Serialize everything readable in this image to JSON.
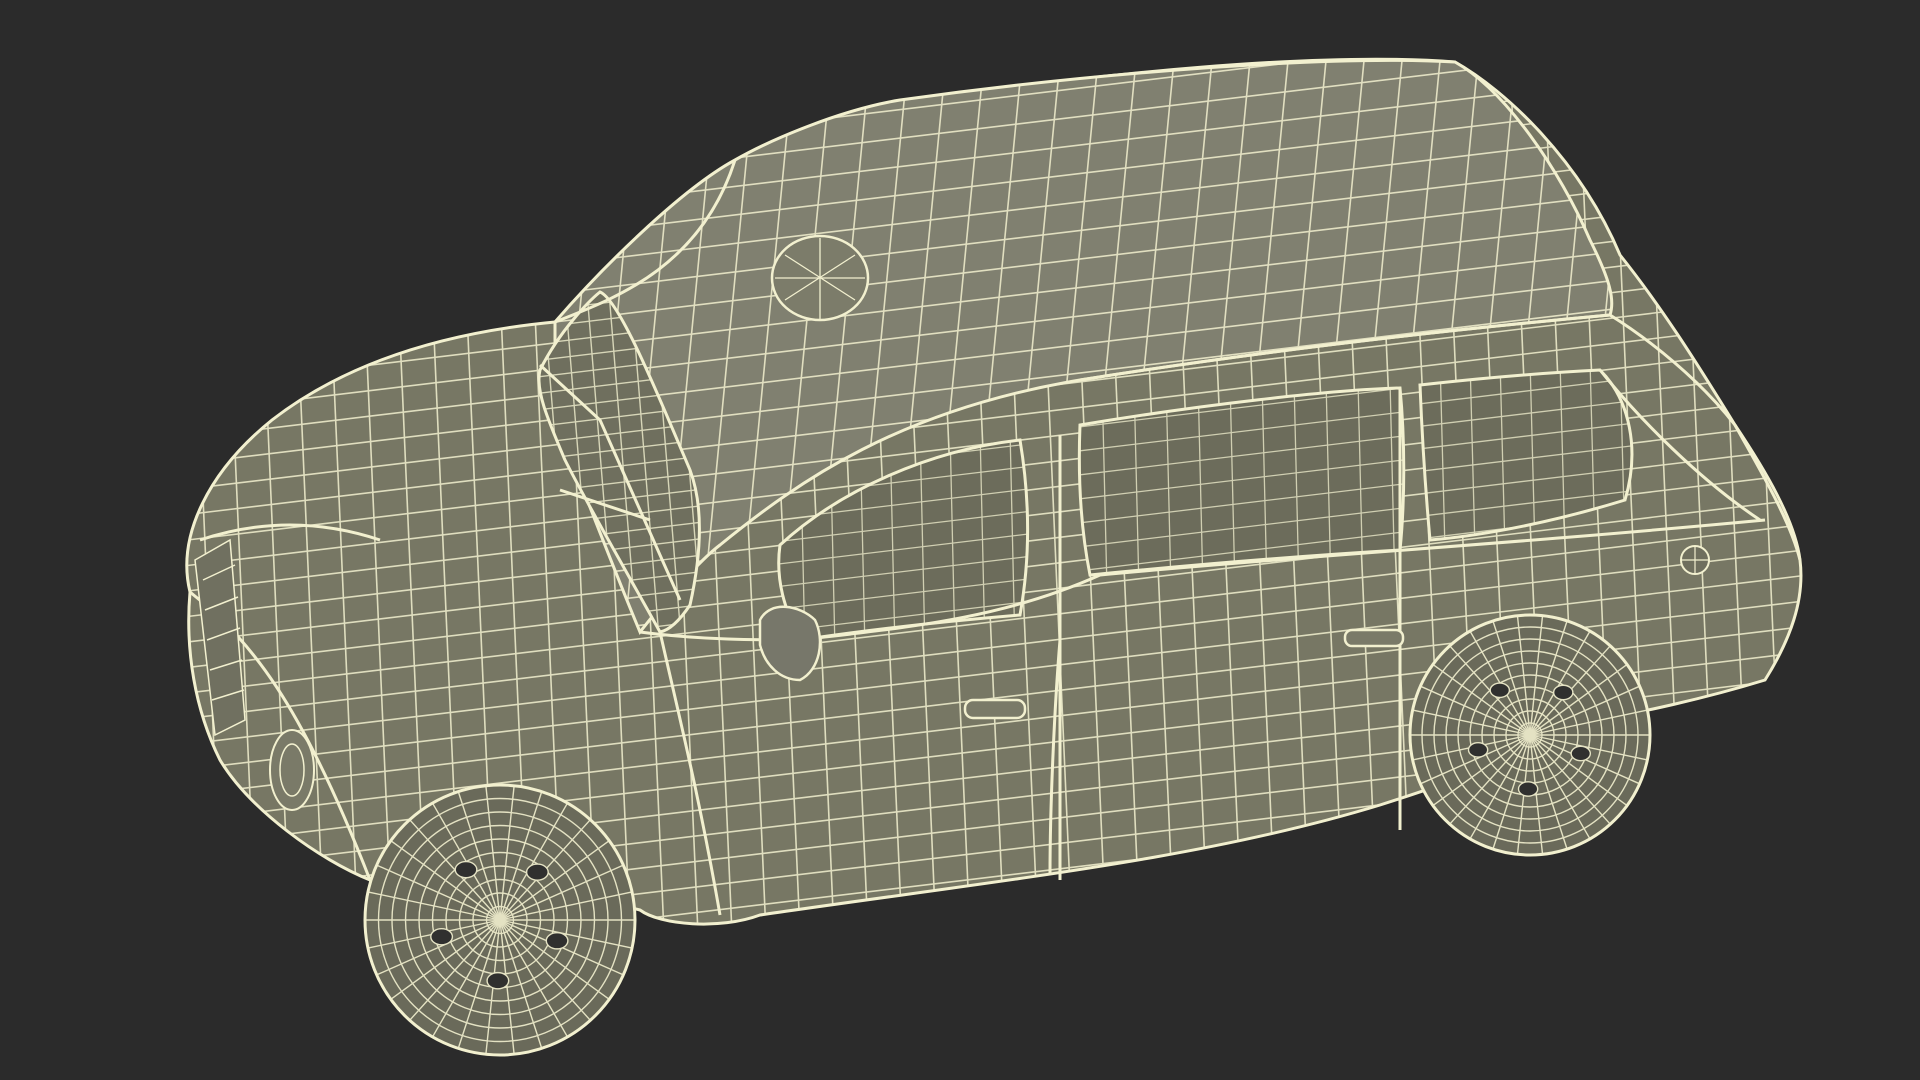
{
  "viewport": {
    "background": "#2b2b2b"
  },
  "model": {
    "subject": "taxi-wireframe-icon",
    "body_color": "#7b7b68",
    "body_dark": "#6a6a58",
    "wire_color": "#f2f0cf",
    "wheel_color": "#6c6c5c"
  }
}
